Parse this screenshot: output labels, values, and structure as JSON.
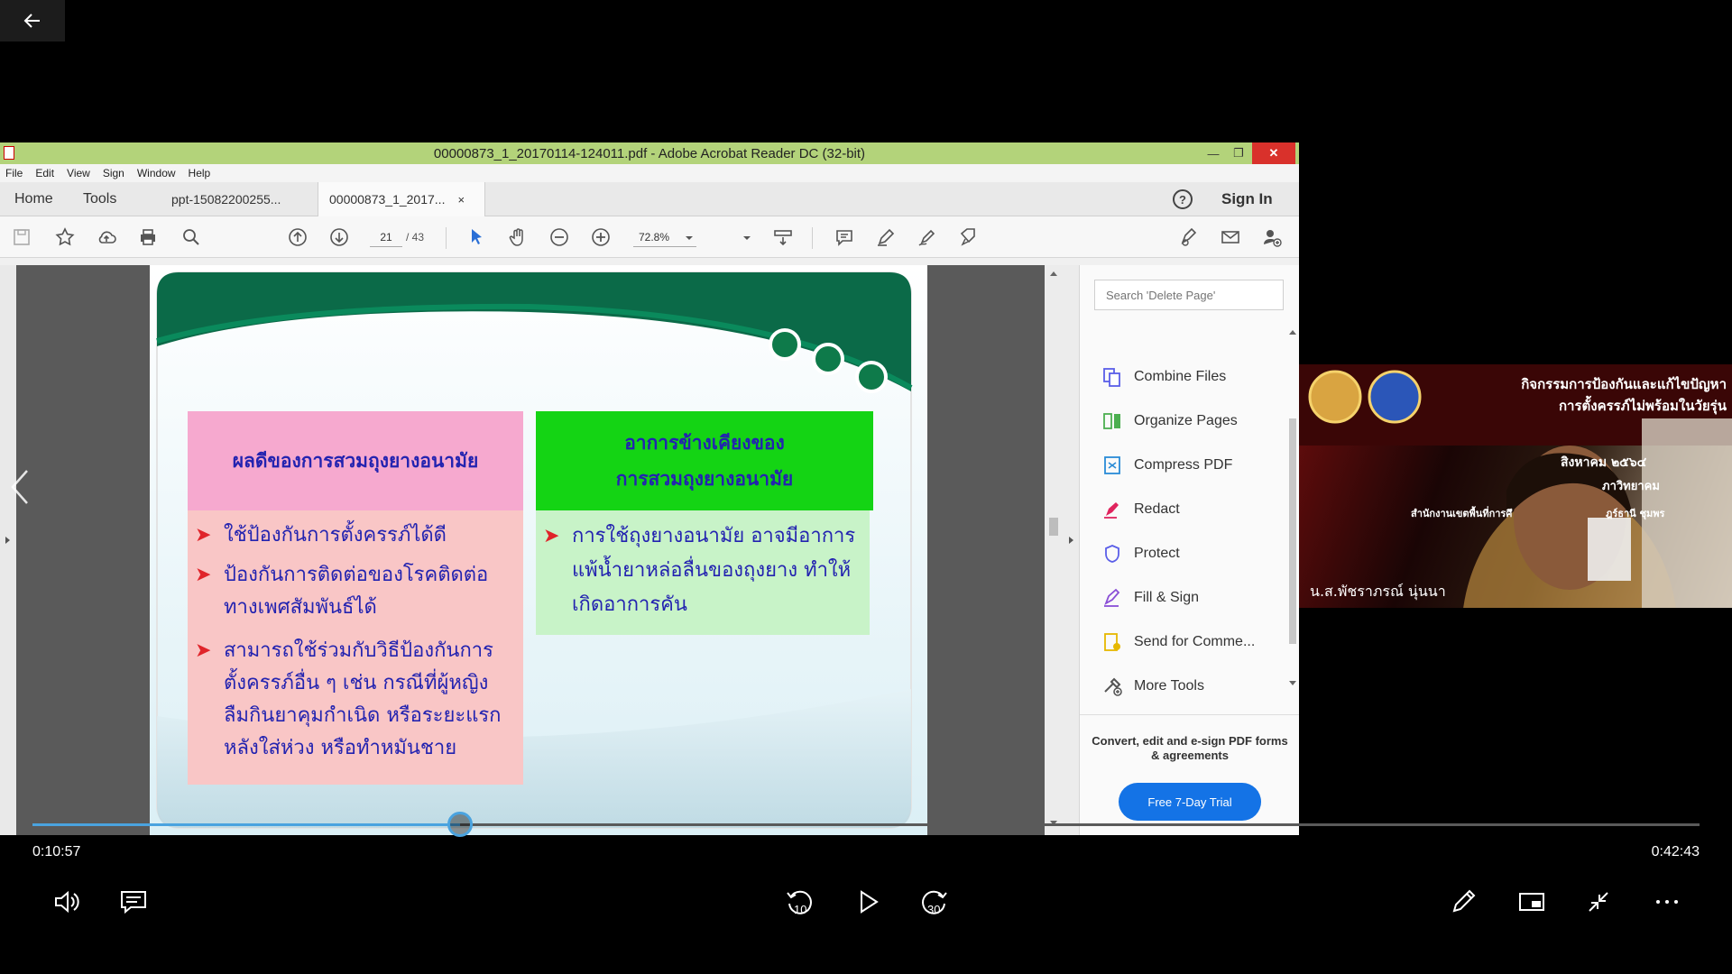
{
  "player": {
    "current_time": "0:10:57",
    "total_time": "0:42:43",
    "progress_fraction": 0.2563
  },
  "acrobat": {
    "window_title": "00000873_1_20170114-124011.pdf - Adobe Acrobat Reader DC (32-bit)",
    "menu": [
      "File",
      "Edit",
      "View",
      "Sign",
      "Window",
      "Help"
    ],
    "nav": {
      "home": "Home",
      "tools": "Tools"
    },
    "tabs": [
      {
        "label": "ppt-15082200255..."
      },
      {
        "label": "00000873_1_2017...",
        "close": "×"
      }
    ],
    "help": "?",
    "sign_in": "Sign In",
    "toolbar": {
      "page_current": "21",
      "page_total": "/ 43",
      "zoom": "72.8%"
    },
    "panel": {
      "search_placeholder": "Search 'Delete Page'",
      "items": [
        "Combine Files",
        "Organize Pages",
        "Compress PDF",
        "Redact",
        "Protect",
        "Fill & Sign",
        "Send for Comme...",
        "More Tools"
      ],
      "promo": "Convert, edit and e-sign PDF forms & agreements",
      "trial_button": "Free 7-Day Trial"
    }
  },
  "slide": {
    "left_header": "ผลดีของการสวมถุงยางอนามัย",
    "right_header_line1": "อาการข้างเคียงของ",
    "right_header_line2": "การสวมถุงยางอนามัย",
    "left_bullets": [
      [
        "ใช้ป้องกันการตั้งครรภ์ได้ดี"
      ],
      [
        "ป้องกันการติดต่อของโรคติดต่อ",
        "ทางเพศสัมพันธ์ได้"
      ],
      [
        "สามารถใช้ร่วมกับวิธีป้องกันการ",
        "ตั้งครรภ์อื่น ๆ เช่น กรณีที่ผู้หญิง",
        "ลืมกินยาคุมกำเนิด หรือระยะแรก",
        "หลังใส่ห่วง หรือทำหมันชาย"
      ]
    ],
    "right_bullets": [
      [
        "การใช้ถุงยางอนามัย อาจมีอาการ",
        "แพ้น้ำยาหล่อลื่นของถุงยาง ทำให้",
        "เกิดอาการคัน"
      ]
    ]
  },
  "webcam": {
    "banner_line1": "กิจกรรมการป้องกันและแก้ไขปัญหา",
    "banner_line2": "การตั้งครรภ์ไม่พร้อมในวัยรุ่น",
    "month_text": "สิงหาคม ๒๕๖๔",
    "college_text": "ภาวิทยาคม",
    "office_text": "สำนักงานเขตพื้นที่การศึ",
    "province_text": "ฎร์ธานี ชุมพร",
    "speaker_name": "น.ส.พัชราภรณ์ นุ่นนา"
  },
  "colors": {
    "acrobat_titlebar": "#b3d37a",
    "slide_header_left": "#f6a9cf",
    "slide_header_right": "#14d414",
    "slide_body_left": "#f9c6c6",
    "slide_body_right": "#c8f3c8",
    "slide_text": "#2323b0",
    "bullet_arrow": "#e0242a",
    "trial_button": "#1473e6",
    "seek_accent": "#4aa3df"
  },
  "icons": {
    "back": "arrow-left-icon",
    "volume": "volume-icon",
    "captions": "captions-icon",
    "rewind": "rewind-10-icon",
    "play": "play-icon",
    "forward": "forward-30-icon",
    "pen": "pen-icon",
    "miniplayer": "miniplayer-icon",
    "exit_fullscreen": "exit-fullscreen-icon",
    "more": "more-icon",
    "rewind_label": "10",
    "forward_label": "30"
  }
}
